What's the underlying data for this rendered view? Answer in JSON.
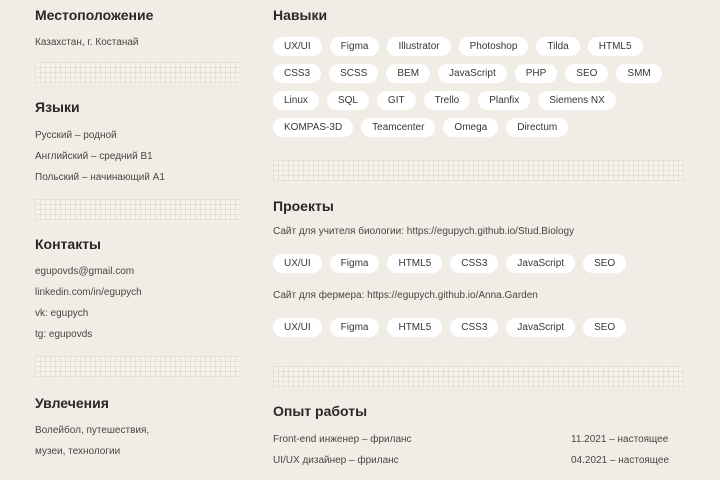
{
  "location": {
    "title": "Местоположение",
    "value": "Казахстан, г. Костанай"
  },
  "languages": {
    "title": "Языки",
    "items": [
      "Русский – родной",
      "Английский – средний B1",
      "Польский – начинающий A1"
    ]
  },
  "contacts": {
    "title": "Контакты",
    "items": [
      "egupovds@gmail.com",
      "linkedin.com/in/egupych",
      "vk: egupych",
      "tg: egupovds"
    ]
  },
  "hobbies": {
    "title": "Увлечения",
    "lines": [
      "Волейбол, путешествия,",
      "музеи, технологии"
    ]
  },
  "skills": {
    "title": "Навыки",
    "items": [
      "UX/UI",
      "Figma",
      "Illustrator",
      "Photoshop",
      "Tilda",
      "HTML5",
      "CSS3",
      "SCSS",
      "BEM",
      "JavaScript",
      "PHP",
      "SEO",
      "SMM",
      "Linux",
      "SQL",
      "GIT",
      "Trello",
      "Planfix",
      "Siemens NX",
      "KOMPAS-3D",
      "Teamcenter",
      "Omega",
      "Directum"
    ]
  },
  "projects": {
    "title": "Проекты",
    "items": [
      {
        "label": "Сайт для учителя биологии: https://egupych.github.io/Stud.Biology",
        "tags": [
          "UX/UI",
          "Figma",
          "HTML5",
          "CSS3",
          "JavaScript",
          "SEO"
        ]
      },
      {
        "label": "Сайт для фермера: https://egupych.github.io/Anna.Garden",
        "tags": [
          "UX/UI",
          "Figma",
          "HTML5",
          "CSS3",
          "JavaScript",
          "SEO"
        ]
      }
    ]
  },
  "experience": {
    "title": "Опыт работы",
    "items": [
      {
        "title": "Front-end инженер – фриланс",
        "dates": "11.2021 – настоящее"
      },
      {
        "title": "UI/UX дизайнер – фриланс",
        "dates": "04.2021 – настоящее"
      }
    ]
  }
}
